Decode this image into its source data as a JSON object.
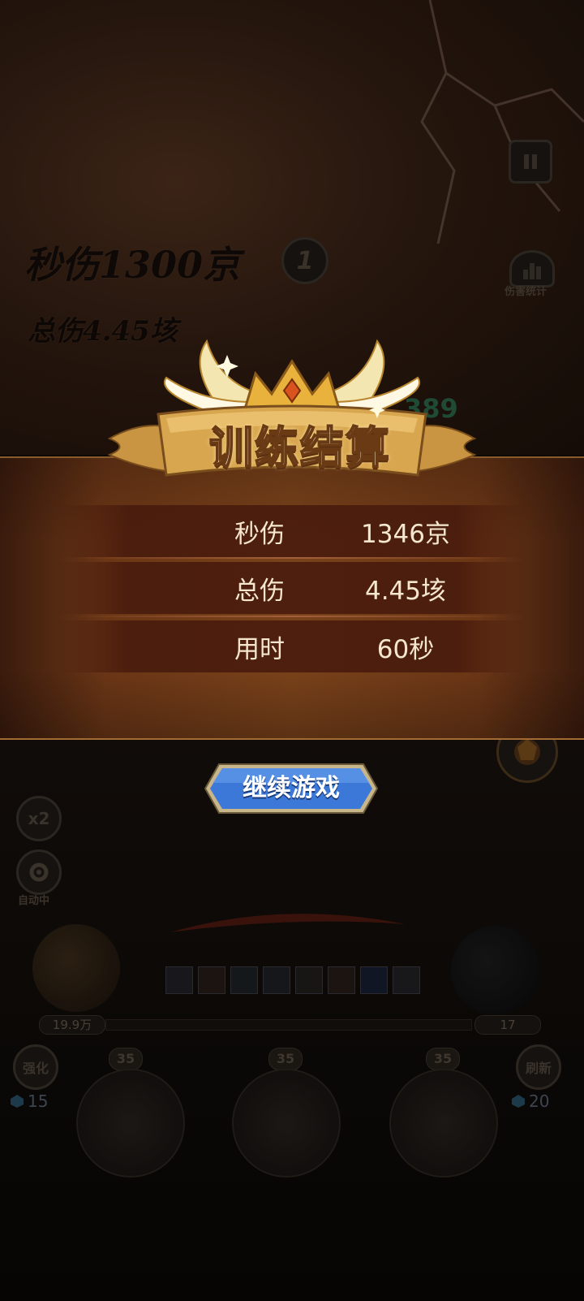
{
  "background": {
    "dps_text": "秒伤1300京",
    "total_text": "总伤4.45垓",
    "round_number": "1",
    "damage_stats_label": "伤害统计",
    "combo_number": "389",
    "speed_label": "x2",
    "auto_label": "自动中",
    "left_hp": "19.9万",
    "right_hp": "17",
    "upgrade_label": "强化",
    "upgrade_cost": "15",
    "refresh_label": "刷新",
    "refresh_cost": "20",
    "card_levels": [
      "35",
      "35",
      "35"
    ],
    "icons": [
      "pause-icon",
      "bar-chart-icon",
      "gear-icon",
      "gem-icon",
      "skill-icon",
      "boss-portrait-icon"
    ]
  },
  "result": {
    "title": "训练结算",
    "rows": [
      {
        "label": "秒伤",
        "value": "1346京"
      },
      {
        "label": "总伤",
        "value": "4.45垓"
      },
      {
        "label": "用时",
        "value": "60秒"
      }
    ],
    "continue_label": "继续游戏"
  },
  "colors": {
    "panel": "#7a421a",
    "title_gold": "#e8b23c",
    "button_blue": "#3b78d8",
    "text": "#f4e6cf"
  }
}
